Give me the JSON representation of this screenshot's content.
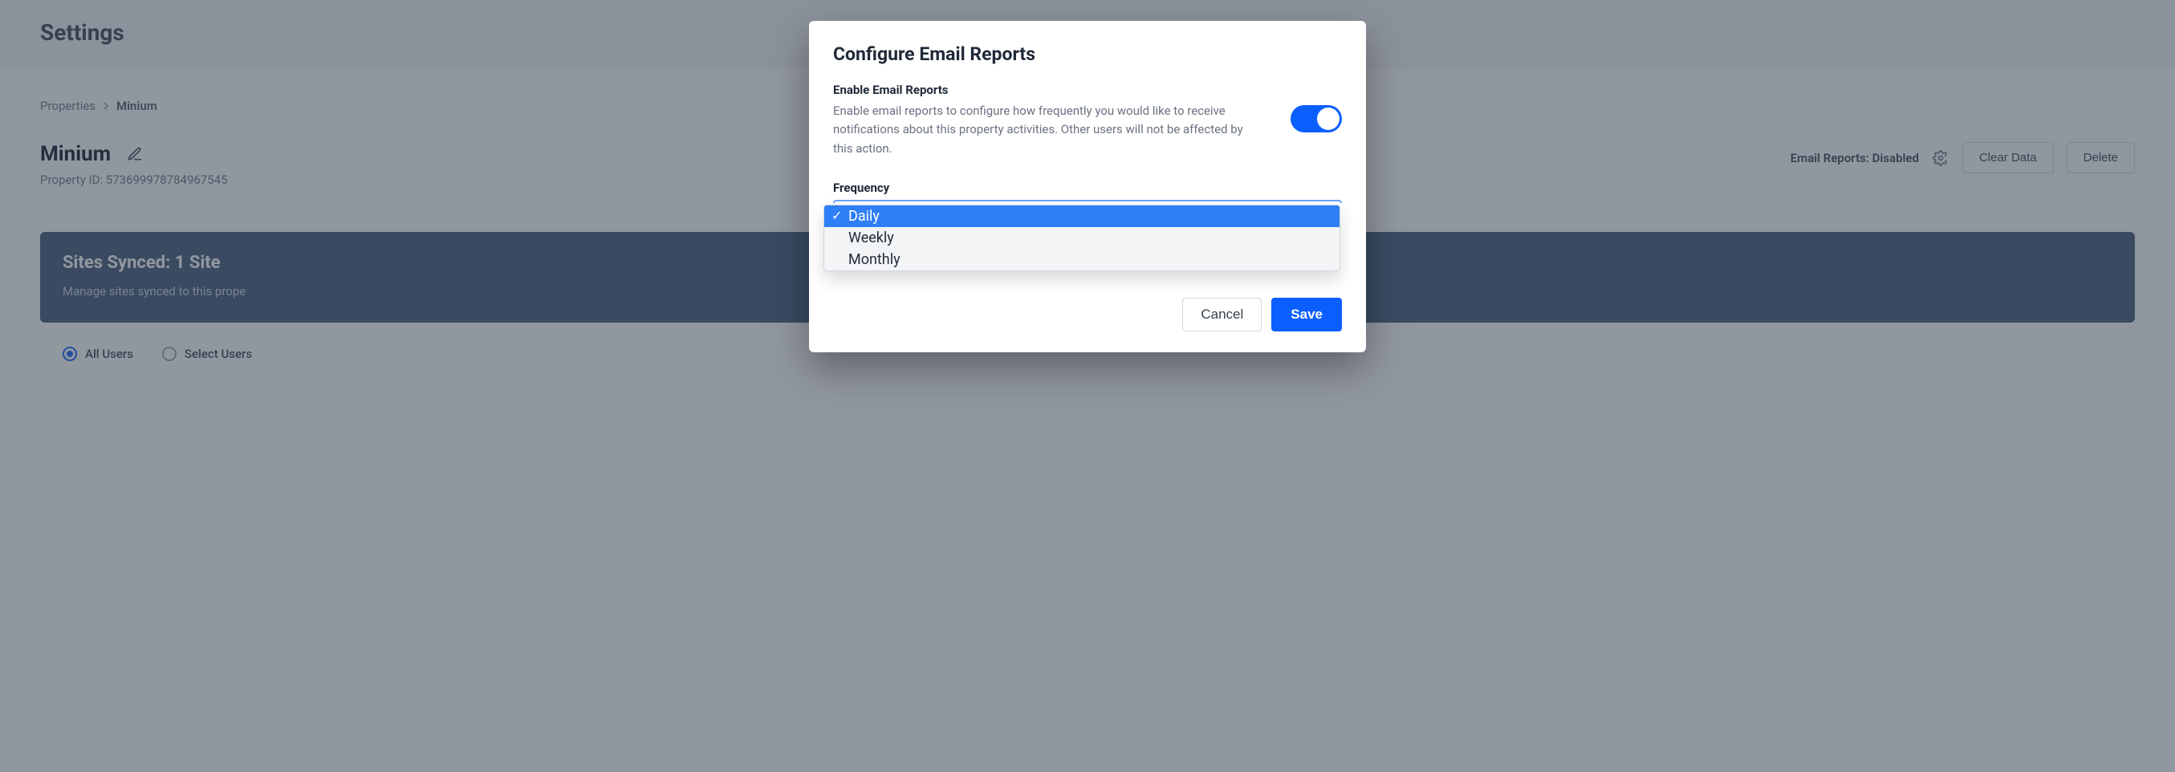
{
  "header": {
    "title": "Settings"
  },
  "breadcrumb": {
    "items": [
      "Properties",
      "Minium"
    ]
  },
  "property": {
    "name": "Minium",
    "id_label": "Property ID: 573699978784967545"
  },
  "actions": {
    "email_reports_status": "Email Reports: Disabled",
    "clear_data": "Clear Data",
    "delete": "Delete"
  },
  "sites_card": {
    "title": "Sites Synced: 1 Site",
    "description": "Manage sites synced to this prope"
  },
  "user_filter": {
    "all": "All Users",
    "select": "Select Users"
  },
  "modal": {
    "title": "Configure Email Reports",
    "enable_label": "Enable Email Reports",
    "enable_desc": "Enable email reports to configure how frequently you would like to receive notifications about this property activities. Other users will not be affected by this action.",
    "frequency_label": "Frequency",
    "options": {
      "daily": "Daily",
      "weekly": "Weekly",
      "monthly": "Monthly"
    },
    "cancel": "Cancel",
    "save": "Save"
  }
}
